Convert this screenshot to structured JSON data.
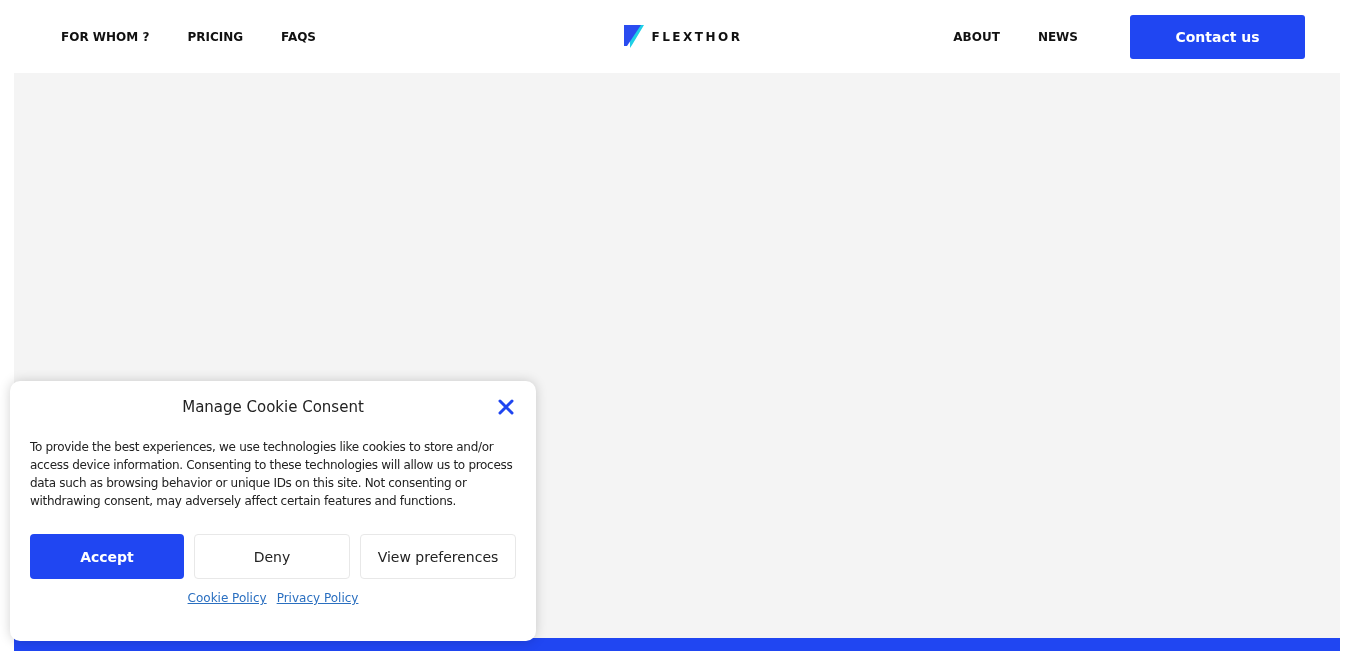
{
  "header": {
    "nav_left": [
      "FOR WHOM ?",
      "PRICING",
      "FAQS"
    ],
    "logo": "FLEXTHOR",
    "nav_right": [
      "ABOUT",
      "NEWS"
    ],
    "cta": "Contact us"
  },
  "cookie_dialog": {
    "title": "Manage Cookie Consent",
    "body": "To provide the best experiences, we use technologies like cookies to store and/or access device information. Consenting to these technologies will allow us to process data such as browsing behavior or unique IDs on this site. Not consenting or withdrawing consent, may adversely affect certain features and functions.",
    "buttons": [
      {
        "label": "Accept",
        "kind": "primary"
      },
      {
        "label": "Deny",
        "kind": "secondary"
      },
      {
        "label": "View preferences",
        "kind": "secondary"
      }
    ],
    "links": [
      "Cookie Policy",
      "Privacy Policy"
    ]
  }
}
